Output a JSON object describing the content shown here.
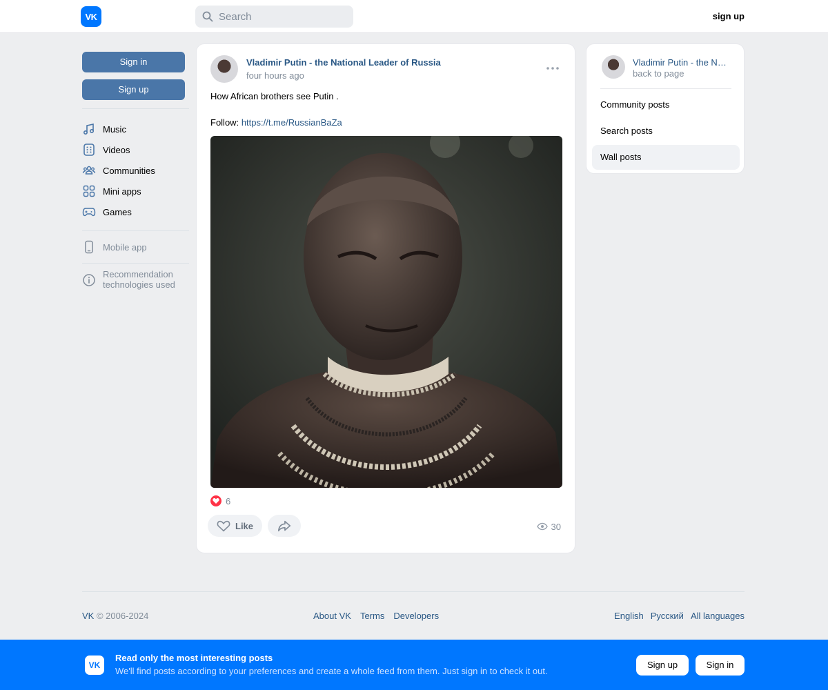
{
  "header": {
    "logo": "VK",
    "search_placeholder": "Search",
    "signup_label": "sign up"
  },
  "sidebar": {
    "signin_label": "Sign in",
    "signup_label": "Sign up",
    "items": [
      {
        "label": "Music",
        "icon": "music-icon"
      },
      {
        "label": "Videos",
        "icon": "videos-icon"
      },
      {
        "label": "Communities",
        "icon": "communities-icon"
      },
      {
        "label": "Mini apps",
        "icon": "mini-apps-icon"
      },
      {
        "label": "Games",
        "icon": "games-icon"
      }
    ],
    "mobile_app_label": "Mobile app",
    "recommendation_line1": "Recommendation",
    "recommendation_line2": "technologies used"
  },
  "post": {
    "author": "Vladimir Putin - the National Leader of Russia",
    "time": "four hours ago",
    "text": "How African brothers see Putin .",
    "follow_label": "Follow:",
    "follow_link": "https://t.me/RussianBaZa",
    "reactions_count": "6",
    "like_label": "Like",
    "views_count": "30"
  },
  "right_panel": {
    "name": "Vladimir Putin - the National Leader of Russia",
    "back_label": "back to page",
    "items": [
      {
        "label": "Community posts"
      },
      {
        "label": "Search posts"
      },
      {
        "label": "Wall posts",
        "active": true
      }
    ]
  },
  "footer": {
    "vk": "VK",
    "copyright": "© 2006-2024",
    "links": [
      "About VK",
      "Terms",
      "Developers"
    ],
    "languages": [
      "English",
      "Русский",
      "All languages"
    ]
  },
  "banner": {
    "logo": "VK",
    "title": "Read only the most interesting posts",
    "description": "We'll find posts according to your preferences and create a whole feed from them. Just sign in to check it out.",
    "signup_label": "Sign up",
    "signin_label": "Sign in"
  },
  "colors": {
    "accent": "#0077ff",
    "link": "#2a5885",
    "button": "#4a76a8",
    "background": "#edeef0"
  }
}
